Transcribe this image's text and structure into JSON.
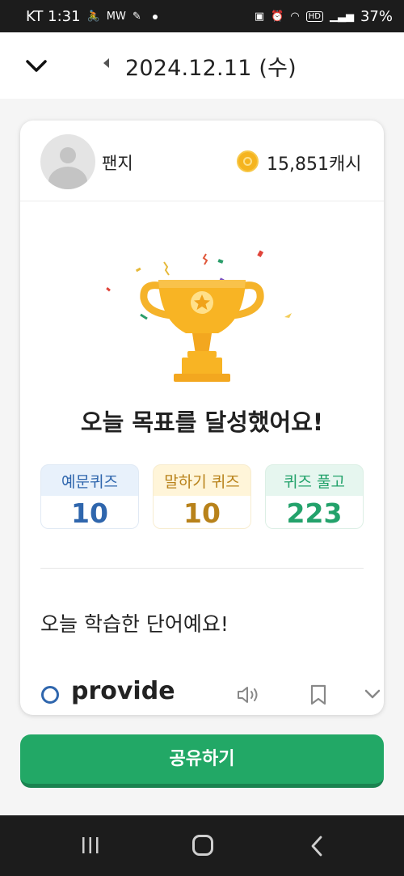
{
  "status_bar": {
    "carrier_time": "KT 1:31",
    "mw_label": "MW",
    "hd_label": "HD",
    "battery": "37%"
  },
  "header": {
    "date": "2024.12.11 (수)"
  },
  "profile": {
    "username": "팬지",
    "cash": "15,851캐시"
  },
  "achievement": {
    "message": "오늘 목표를 달성했어요!"
  },
  "stats": [
    {
      "label": "예문퀴즈 ",
      "value": "10"
    },
    {
      "label": "말하기 퀴즈",
      "value": "10"
    },
    {
      "label": "퀴즈 풀고",
      "value": "223"
    }
  ],
  "words_section": {
    "title": "오늘 학습한 단어예요!",
    "words": [
      {
        "word": "provide"
      }
    ]
  },
  "share_button": {
    "label": "공유하기"
  },
  "colors": {
    "brand_green": "#22a866",
    "blue": "#2f66ad",
    "gold": "#b8821a",
    "green": "#23a26b"
  }
}
